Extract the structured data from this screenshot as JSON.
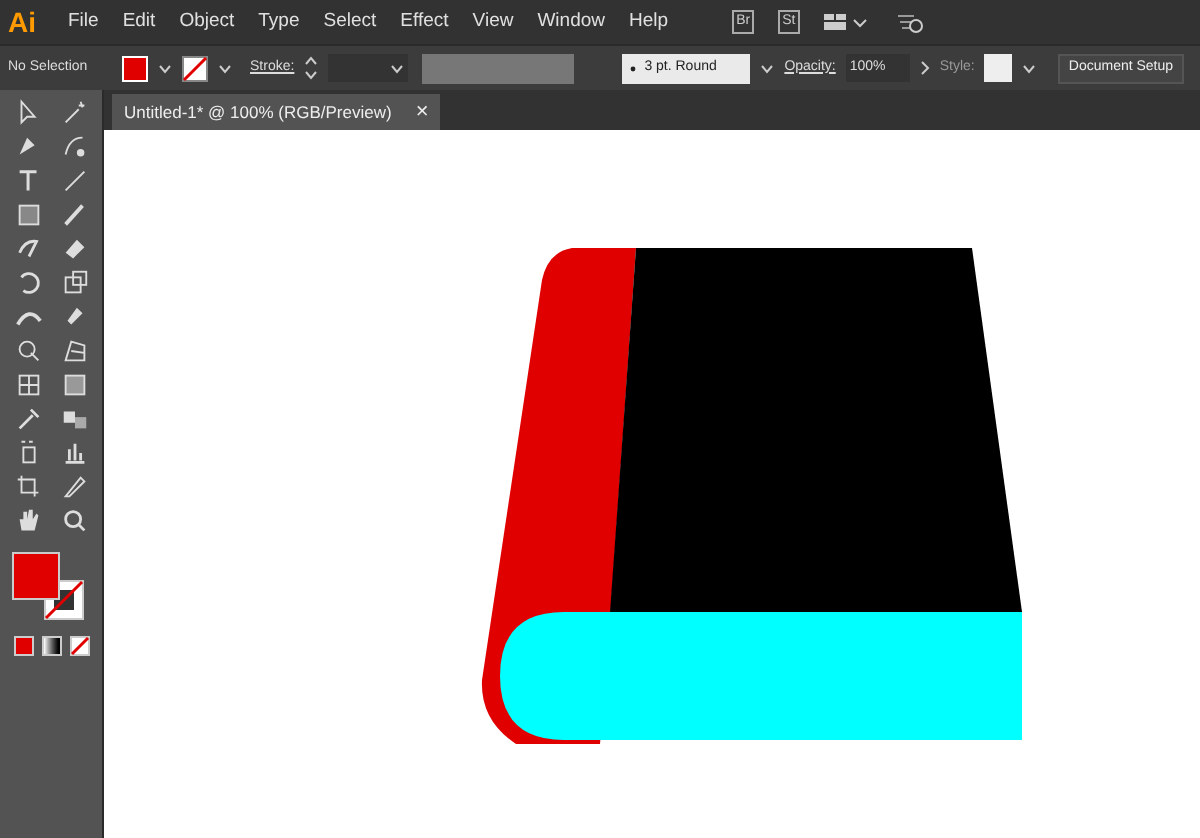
{
  "app": {
    "logo": "Ai",
    "menu": [
      "File",
      "Edit",
      "Object",
      "Type",
      "Select",
      "Effect",
      "View",
      "Window",
      "Help"
    ],
    "badges": [
      "Br",
      "St"
    ]
  },
  "control_bar": {
    "selection": "No Selection",
    "stroke_label": "Stroke:",
    "brush": "3 pt. Round",
    "opacity_label": "Opacity:",
    "opacity": "100%",
    "style_label": "Style:",
    "document_setup": "Document Setup"
  },
  "document_tab": {
    "title": "Untitled-1* @ 100% (RGB/Preview)",
    "close": "×",
    "selected": true
  }
}
